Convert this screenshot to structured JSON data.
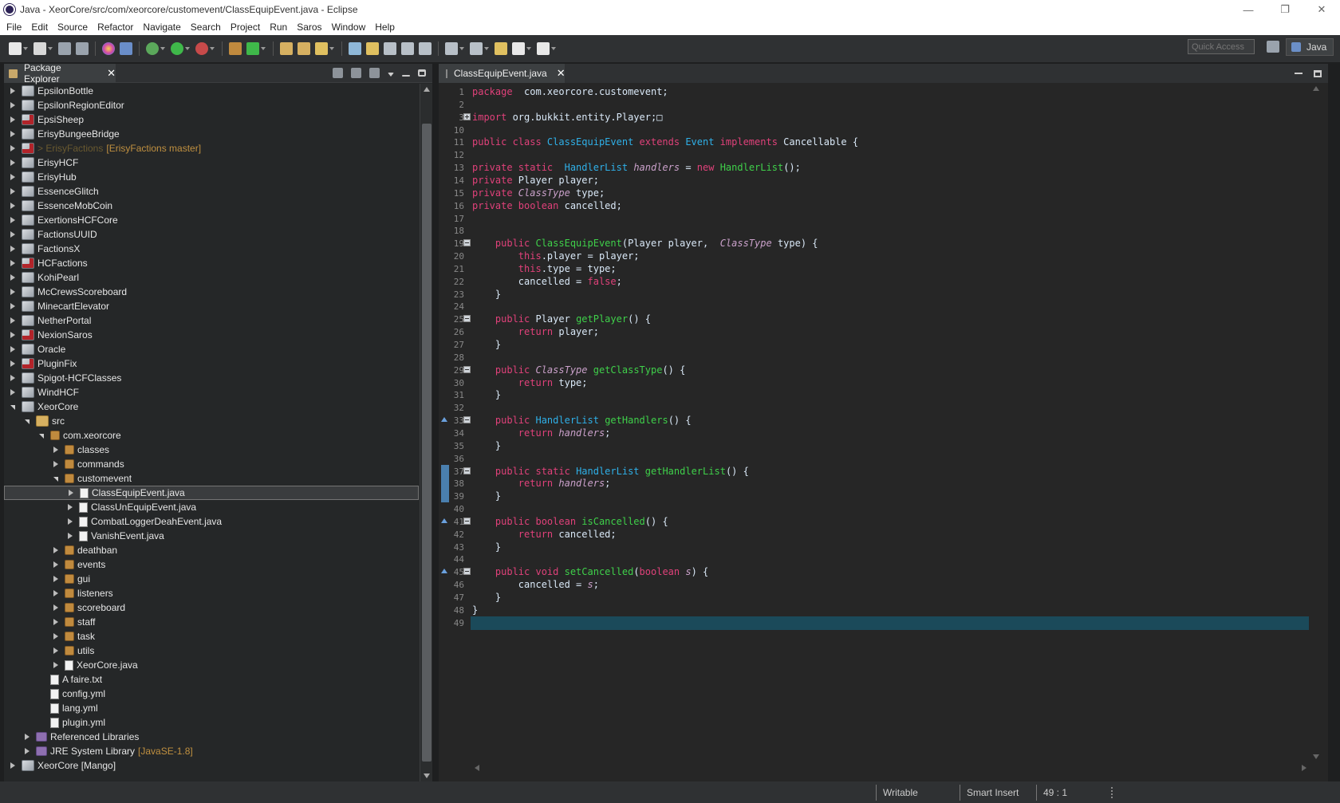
{
  "window": {
    "title": "Java - XeorCore/src/com/xeorcore/customevent/ClassEquipEvent.java - Eclipse",
    "controls": [
      "—",
      "❐",
      "✕"
    ]
  },
  "menu": [
    "File",
    "Edit",
    "Source",
    "Refactor",
    "Navigate",
    "Search",
    "Project",
    "Run",
    "Saros",
    "Window",
    "Help"
  ],
  "toolbar": {
    "quick_access_placeholder": "Quick Access",
    "perspective": "Java"
  },
  "package_explorer": {
    "tab_label": "Package Explorer",
    "rows": [
      {
        "label": "EpsilonBottle",
        "depth": 0,
        "twisty": "closed",
        "icon": "project"
      },
      {
        "label": "EpsilonRegionEditor",
        "depth": 0,
        "twisty": "closed",
        "icon": "project"
      },
      {
        "label": "EpsiSheep",
        "depth": 0,
        "twisty": "closed",
        "icon": "project-git"
      },
      {
        "label": "ErisyBungeeBridge",
        "depth": 0,
        "twisty": "closed",
        "icon": "project"
      },
      {
        "label": "> ErisyFactions",
        "depth": 0,
        "twisty": "closed",
        "icon": "project-git",
        "deco": "[ErisyFactions master]",
        "dim": true
      },
      {
        "label": "ErisyHCF",
        "depth": 0,
        "twisty": "closed",
        "icon": "project"
      },
      {
        "label": "ErisyHub",
        "depth": 0,
        "twisty": "closed",
        "icon": "project"
      },
      {
        "label": "EssenceGlitch",
        "depth": 0,
        "twisty": "closed",
        "icon": "project"
      },
      {
        "label": "EssenceMobCoin",
        "depth": 0,
        "twisty": "closed",
        "icon": "project"
      },
      {
        "label": "ExertionsHCFCore",
        "depth": 0,
        "twisty": "closed",
        "icon": "project"
      },
      {
        "label": "FactionsUUID",
        "depth": 0,
        "twisty": "closed",
        "icon": "project"
      },
      {
        "label": "FactionsX",
        "depth": 0,
        "twisty": "closed",
        "icon": "project"
      },
      {
        "label": "HCFactions",
        "depth": 0,
        "twisty": "closed",
        "icon": "project-git"
      },
      {
        "label": "KohiPearl",
        "depth": 0,
        "twisty": "closed",
        "icon": "project"
      },
      {
        "label": "McCrewsScoreboard",
        "depth": 0,
        "twisty": "closed",
        "icon": "project"
      },
      {
        "label": "MinecartElevator",
        "depth": 0,
        "twisty": "closed",
        "icon": "project"
      },
      {
        "label": "NetherPortal",
        "depth": 0,
        "twisty": "closed",
        "icon": "project"
      },
      {
        "label": "NexionSaros",
        "depth": 0,
        "twisty": "closed",
        "icon": "project-git"
      },
      {
        "label": "Oracle",
        "depth": 0,
        "twisty": "closed",
        "icon": "project"
      },
      {
        "label": "PluginFix",
        "depth": 0,
        "twisty": "closed",
        "icon": "project-git"
      },
      {
        "label": "Spigot-HCFClasses",
        "depth": 0,
        "twisty": "closed",
        "icon": "project"
      },
      {
        "label": "WindHCF",
        "depth": 0,
        "twisty": "closed",
        "icon": "project"
      },
      {
        "label": "XeorCore",
        "depth": 0,
        "twisty": "open",
        "icon": "project"
      },
      {
        "label": "src",
        "depth": 1,
        "twisty": "open",
        "icon": "folder"
      },
      {
        "label": "com.xeorcore",
        "depth": 2,
        "twisty": "open",
        "icon": "package"
      },
      {
        "label": "classes",
        "depth": 3,
        "twisty": "closed",
        "icon": "package"
      },
      {
        "label": "commands",
        "depth": 3,
        "twisty": "closed",
        "icon": "package"
      },
      {
        "label": "customevent",
        "depth": 3,
        "twisty": "open",
        "icon": "package"
      },
      {
        "label": "ClassEquipEvent.java",
        "depth": 4,
        "twisty": "closed",
        "icon": "java",
        "selected": true
      },
      {
        "label": "ClassUnEquipEvent.java",
        "depth": 4,
        "twisty": "closed",
        "icon": "java"
      },
      {
        "label": "CombatLoggerDeahEvent.java",
        "depth": 4,
        "twisty": "closed",
        "icon": "java"
      },
      {
        "label": "VanishEvent.java",
        "depth": 4,
        "twisty": "closed",
        "icon": "java"
      },
      {
        "label": "deathban",
        "depth": 3,
        "twisty": "closed",
        "icon": "package"
      },
      {
        "label": "events",
        "depth": 3,
        "twisty": "closed",
        "icon": "package"
      },
      {
        "label": "gui",
        "depth": 3,
        "twisty": "closed",
        "icon": "package"
      },
      {
        "label": "listeners",
        "depth": 3,
        "twisty": "closed",
        "icon": "package"
      },
      {
        "label": "scoreboard",
        "depth": 3,
        "twisty": "closed",
        "icon": "package"
      },
      {
        "label": "staff",
        "depth": 3,
        "twisty": "closed",
        "icon": "package"
      },
      {
        "label": "task",
        "depth": 3,
        "twisty": "closed",
        "icon": "package"
      },
      {
        "label": "utils",
        "depth": 3,
        "twisty": "closed",
        "icon": "package"
      },
      {
        "label": "XeorCore.java",
        "depth": 3,
        "twisty": "closed",
        "icon": "java"
      },
      {
        "label": "A faire.txt",
        "depth": 2,
        "twisty": "none",
        "icon": "file"
      },
      {
        "label": "config.yml",
        "depth": 2,
        "twisty": "none",
        "icon": "file"
      },
      {
        "label": "lang.yml",
        "depth": 2,
        "twisty": "none",
        "icon": "file"
      },
      {
        "label": "plugin.yml",
        "depth": 2,
        "twisty": "none",
        "icon": "file"
      },
      {
        "label": "Referenced Libraries",
        "depth": 1,
        "twisty": "closed",
        "icon": "lib"
      },
      {
        "label": "JRE System Library",
        "depth": 1,
        "twisty": "closed",
        "icon": "lib",
        "deco": "[JavaSE-1.8]"
      },
      {
        "label": "XeorCore [Mango]",
        "depth": 0,
        "twisty": "closed",
        "icon": "project"
      }
    ]
  },
  "editor": {
    "tab_label": "ClassEquipEvent.java",
    "lines": [
      {
        "n": "1",
        "t": [
          [
            "kw",
            "package"
          ],
          [
            "",
            "  com.xeorcore.customevent;"
          ]
        ]
      },
      {
        "n": "2",
        "t": []
      },
      {
        "n": "3",
        "fold": "plus",
        "t": [
          [
            "kw",
            "import"
          ],
          [
            "",
            " org.bukkit.entity.Player;□"
          ]
        ]
      },
      {
        "n": "10",
        "t": []
      },
      {
        "n": "11",
        "t": [
          [
            "kw",
            "public class "
          ],
          [
            "cls",
            "ClassEquipEvent"
          ],
          [
            "kw",
            " extends "
          ],
          [
            "cls",
            "Event"
          ],
          [
            "kw",
            " implements "
          ],
          [
            "",
            "Cancellable {"
          ]
        ]
      },
      {
        "n": "12",
        "t": []
      },
      {
        "n": "13",
        "t": [
          [
            "kw",
            "private static  "
          ],
          [
            "cls",
            "HandlerList"
          ],
          [
            "",
            " "
          ],
          [
            "it",
            "handlers"
          ],
          [
            "",
            " = "
          ],
          [
            "kw",
            "new "
          ],
          [
            "fn",
            "HandlerList"
          ],
          [
            "",
            "();"
          ]
        ]
      },
      {
        "n": "14",
        "t": [
          [
            "kw",
            "private "
          ],
          [
            "",
            "Player player;"
          ]
        ]
      },
      {
        "n": "15",
        "t": [
          [
            "kw",
            "private "
          ],
          [
            "it",
            "ClassType"
          ],
          [
            "",
            " type;"
          ]
        ]
      },
      {
        "n": "16",
        "t": [
          [
            "kw",
            "private boolean "
          ],
          [
            "",
            "cancelled;"
          ]
        ]
      },
      {
        "n": "17",
        "t": []
      },
      {
        "n": "18",
        "t": []
      },
      {
        "n": "19",
        "fold": "minus",
        "t": [
          [
            "",
            "    "
          ],
          [
            "kw",
            "public "
          ],
          [
            "fn",
            "ClassEquipEvent"
          ],
          [
            "",
            "(Player player,  "
          ],
          [
            "it",
            "ClassType"
          ],
          [
            "",
            " type) {"
          ]
        ]
      },
      {
        "n": "20",
        "t": [
          [
            "",
            "        "
          ],
          [
            "kw",
            "this"
          ],
          [
            "",
            ".player = player;"
          ]
        ]
      },
      {
        "n": "21",
        "t": [
          [
            "",
            "        "
          ],
          [
            "kw",
            "this"
          ],
          [
            "",
            ".type = type;"
          ]
        ]
      },
      {
        "n": "22",
        "t": [
          [
            "",
            "        cancelled = "
          ],
          [
            "kw",
            "false"
          ],
          [
            "",
            ";"
          ]
        ]
      },
      {
        "n": "23",
        "t": [
          [
            "",
            "    }"
          ]
        ]
      },
      {
        "n": "24",
        "t": []
      },
      {
        "n": "25",
        "fold": "minus",
        "t": [
          [
            "",
            "    "
          ],
          [
            "kw",
            "public "
          ],
          [
            "",
            "Player "
          ],
          [
            "fn",
            "getPlayer"
          ],
          [
            "",
            "() {"
          ]
        ]
      },
      {
        "n": "26",
        "t": [
          [
            "",
            "        "
          ],
          [
            "kw",
            "return "
          ],
          [
            "",
            "player;"
          ]
        ]
      },
      {
        "n": "27",
        "t": [
          [
            "",
            "    }"
          ]
        ]
      },
      {
        "n": "28",
        "t": []
      },
      {
        "n": "29",
        "fold": "minus",
        "t": [
          [
            "",
            "    "
          ],
          [
            "kw",
            "public "
          ],
          [
            "it",
            "ClassType"
          ],
          [
            "",
            " "
          ],
          [
            "fn",
            "getClassType"
          ],
          [
            "",
            "() {"
          ]
        ]
      },
      {
        "n": "30",
        "t": [
          [
            "",
            "        "
          ],
          [
            "kw",
            "return "
          ],
          [
            "",
            "type;"
          ]
        ]
      },
      {
        "n": "31",
        "t": [
          [
            "",
            "    }"
          ]
        ]
      },
      {
        "n": "32",
        "t": []
      },
      {
        "n": "33",
        "fold": "minus",
        "ovr": true,
        "t": [
          [
            "",
            "    "
          ],
          [
            "kw",
            "public "
          ],
          [
            "cls",
            "HandlerList"
          ],
          [
            "",
            " "
          ],
          [
            "fn",
            "getHandlers"
          ],
          [
            "",
            "() {"
          ]
        ]
      },
      {
        "n": "34",
        "t": [
          [
            "",
            "        "
          ],
          [
            "kw",
            "return "
          ],
          [
            "it",
            "handlers"
          ],
          [
            "",
            ";"
          ]
        ]
      },
      {
        "n": "35",
        "t": [
          [
            "",
            "    }"
          ]
        ]
      },
      {
        "n": "36",
        "t": []
      },
      {
        "n": "37",
        "fold": "minus",
        "t": [
          [
            "",
            "    "
          ],
          [
            "kw",
            "public static "
          ],
          [
            "cls",
            "HandlerList"
          ],
          [
            "",
            " "
          ],
          [
            "fn",
            "getHandlerList"
          ],
          [
            "",
            "() {"
          ]
        ]
      },
      {
        "n": "38",
        "t": [
          [
            "",
            "        "
          ],
          [
            "kw",
            "return "
          ],
          [
            "it",
            "handlers"
          ],
          [
            "",
            ";"
          ]
        ]
      },
      {
        "n": "39",
        "t": [
          [
            "",
            "    }"
          ]
        ]
      },
      {
        "n": "40",
        "t": []
      },
      {
        "n": "41",
        "fold": "minus",
        "ovr": true,
        "t": [
          [
            "",
            "    "
          ],
          [
            "kw",
            "public boolean "
          ],
          [
            "fn",
            "isCancelled"
          ],
          [
            "",
            "() {"
          ]
        ]
      },
      {
        "n": "42",
        "t": [
          [
            "",
            "        "
          ],
          [
            "kw",
            "return "
          ],
          [
            "",
            "cancelled;"
          ]
        ]
      },
      {
        "n": "43",
        "t": [
          [
            "",
            "    }"
          ]
        ]
      },
      {
        "n": "44",
        "t": []
      },
      {
        "n": "45",
        "fold": "minus",
        "ovr": true,
        "t": [
          [
            "",
            "    "
          ],
          [
            "kw",
            "public void "
          ],
          [
            "fn",
            "setCancelled"
          ],
          [
            "",
            "("
          ],
          [
            "kw",
            "boolean "
          ],
          [
            "it",
            "s"
          ],
          [
            "",
            ") {"
          ]
        ]
      },
      {
        "n": "46",
        "t": [
          [
            "",
            "        cancelled = "
          ],
          [
            "it",
            "s"
          ],
          [
            "",
            ";"
          ]
        ]
      },
      {
        "n": "47",
        "t": [
          [
            "",
            "    }"
          ]
        ]
      },
      {
        "n": "48",
        "t": [
          [
            "",
            "}"
          ]
        ]
      },
      {
        "n": "49",
        "current": true,
        "t": []
      }
    ]
  },
  "status": {
    "writable": "Writable",
    "insert_mode": "Smart Insert",
    "position": "49 : 1"
  }
}
